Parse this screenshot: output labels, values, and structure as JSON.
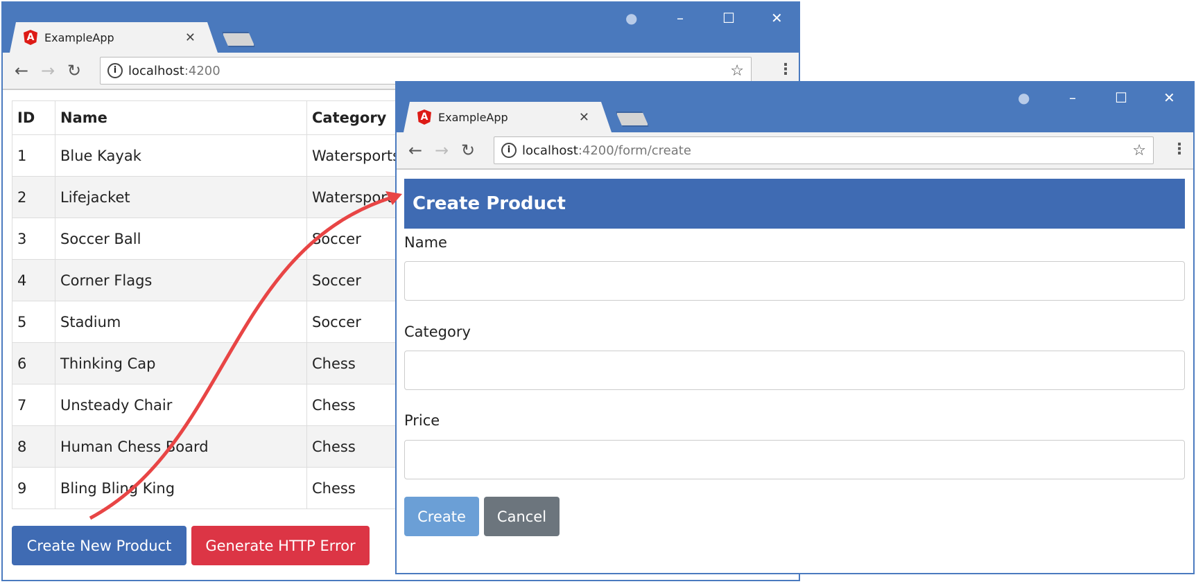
{
  "window1": {
    "tab_title": "ExampleApp",
    "url_host": "localhost",
    "url_rest": ":4200",
    "table": {
      "headers": [
        "ID",
        "Name",
        "Category"
      ],
      "rows": [
        [
          "1",
          "Blue Kayak",
          "Watersports"
        ],
        [
          "2",
          "Lifejacket",
          "Watersports"
        ],
        [
          "3",
          "Soccer Ball",
          "Soccer"
        ],
        [
          "4",
          "Corner Flags",
          "Soccer"
        ],
        [
          "5",
          "Stadium",
          "Soccer"
        ],
        [
          "6",
          "Thinking Cap",
          "Chess"
        ],
        [
          "7",
          "Unsteady Chair",
          "Chess"
        ],
        [
          "8",
          "Human Chess Board",
          "Chess"
        ],
        [
          "9",
          "Bling Bling King",
          "Chess"
        ]
      ]
    },
    "buttons": {
      "create": "Create New Product",
      "error": "Generate HTTP Error"
    }
  },
  "window2": {
    "tab_title": "ExampleApp",
    "url_host": "localhost",
    "url_rest": ":4200/form/create",
    "form": {
      "title": "Create Product",
      "fields": [
        {
          "label": "Name",
          "value": ""
        },
        {
          "label": "Category",
          "value": ""
        },
        {
          "label": "Price",
          "value": ""
        }
      ],
      "create_label": "Create",
      "cancel_label": "Cancel"
    }
  },
  "colors": {
    "chrome": "#4a79bd",
    "primary": "#3f6bb3",
    "danger": "#dc3545",
    "secondary": "#6c757d",
    "arrow": "#e84545"
  },
  "icons": {
    "tab": "angular-logo-icon",
    "back": "arrow-left-icon",
    "forward": "arrow-right-icon",
    "reload": "reload-icon",
    "info": "info-icon",
    "bookmark": "star-icon",
    "menu": "kebab-menu-icon"
  }
}
